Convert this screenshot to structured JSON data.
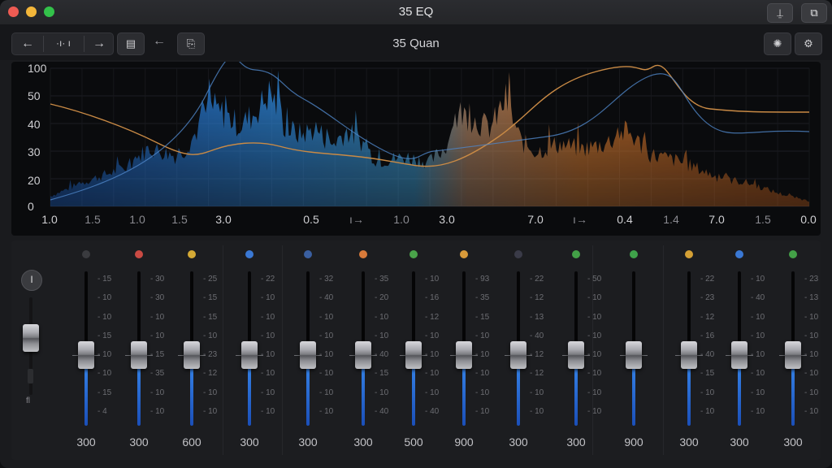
{
  "window": {
    "title": "35 EQ"
  },
  "titlebar_buttons": [
    {
      "icon": "share-icon",
      "glyph": "⍊"
    },
    {
      "icon": "window-icon",
      "glyph": "⧉"
    }
  ],
  "toolbar": {
    "back_glyph": "←",
    "mid_glyph": "·ı·  ı",
    "forward_glyph": "→",
    "doc_glyph": "▤",
    "undo_glyph": "←",
    "page_glyph": "⎘",
    "document_title": "35 Quan",
    "right_icons": [
      {
        "icon": "analyzer-icon",
        "glyph": "✺"
      },
      {
        "icon": "gear-icon",
        "glyph": "⚙"
      }
    ]
  },
  "graph": {
    "y_labels": [
      "100",
      "50",
      "40",
      "30",
      "20",
      "0"
    ],
    "x_labels": [
      {
        "text": "1.0",
        "dim": false
      },
      {
        "text": "1.5",
        "dim": true
      },
      {
        "text": "1.0",
        "dim": true
      },
      {
        "text": "1.5",
        "dim": true
      },
      {
        "text": "3.0",
        "dim": false
      },
      {
        "text": "0.5",
        "dim": false
      },
      {
        "text": "ı→",
        "dim": true
      },
      {
        "text": "1.0",
        "dim": true
      },
      {
        "text": "3.0",
        "dim": false
      },
      {
        "text": "7.0",
        "dim": false
      },
      {
        "text": "ı→",
        "dim": true
      },
      {
        "text": "0.4",
        "dim": false
      },
      {
        "text": "1.4",
        "dim": true
      },
      {
        "text": "7.0",
        "dim": false
      },
      {
        "text": "1.5",
        "dim": true
      },
      {
        "text": "0.0",
        "dim": false
      }
    ],
    "colors": {
      "blue": "#2f7fd8",
      "orange": "#d2782e",
      "curve_orange": "#c98a45",
      "curve_blue": "#4f86c8"
    }
  },
  "mixer": {
    "first_strip": {
      "solo_label": "I",
      "bottom_label": "fl"
    },
    "channels": [
      {
        "color": "#3a3b3f",
        "value": "300",
        "level": 0.52,
        "scale": [
          "15",
          "10",
          "10",
          "15",
          "10",
          "10",
          "15",
          "4"
        ],
        "scale_right": []
      },
      {
        "color": "#c94a43",
        "value": "300",
        "level": 0.52,
        "scale": [
          "30",
          "30",
          "10",
          "10",
          "15",
          "35",
          "10",
          "10"
        ],
        "scale_right": []
      },
      {
        "color": "#d4a935",
        "value": "600",
        "level": 0.52,
        "scale": [
          "25",
          "15",
          "15",
          "10",
          "23",
          "12",
          "10",
          "10"
        ],
        "scale_right": []
      },
      {
        "color": "#3a78d4",
        "value": "300",
        "level": 0.52,
        "scale": [
          "22",
          "10",
          "10",
          "10",
          "10",
          "10",
          "10",
          "10"
        ],
        "scale_right": []
      },
      {
        "color": "#3a5fa0",
        "value": "300",
        "level": 0.52,
        "scale": [
          "32",
          "40",
          "10",
          "10",
          "10",
          "10",
          "10",
          "10"
        ],
        "scale_right": []
      },
      {
        "color": "#d87a3a",
        "value": "300",
        "level": 0.52,
        "scale": [
          "35",
          "20",
          "10",
          "10",
          "40",
          "15",
          "10",
          "40"
        ],
        "scale_right": []
      },
      {
        "color": "#4aa34a",
        "value": "500",
        "level": 0.52,
        "scale": [
          "10",
          "16",
          "12",
          "10",
          "10",
          "10",
          "10",
          "40"
        ],
        "scale_right": []
      },
      {
        "color": "#d89a3a",
        "value": "900",
        "level": 0.52,
        "scale": [
          "93",
          "35",
          "15",
          "10",
          "10",
          "10",
          "10",
          "10"
        ],
        "scale_right": []
      },
      {
        "color": "#3a3b48",
        "value": "300",
        "level": 0.52,
        "scale": [
          "22",
          "12",
          "13",
          "40",
          "12",
          "12",
          "10",
          "10"
        ],
        "scale_right": []
      },
      {
        "color": "#43a047",
        "value": "300",
        "level": 0.52,
        "scale": [
          "50",
          "10",
          "10",
          "10",
          "10",
          "10",
          "10",
          "10"
        ],
        "scale_right": []
      },
      {
        "color": "#3fa34a",
        "value": "900",
        "level": 0.52,
        "scale": [],
        "scale_right": []
      },
      {
        "color": "#d4a035",
        "value": "300",
        "level": 0.52,
        "scale": [
          "22",
          "23",
          "12",
          "16",
          "40",
          "15",
          "10",
          "10"
        ],
        "scale_right": []
      },
      {
        "color": "#3a78d4",
        "value": "300",
        "level": 0.52,
        "scale": [
          "10",
          "40",
          "10",
          "10",
          "10",
          "10",
          "10",
          "10"
        ],
        "scale_right": []
      },
      {
        "color": "#43a047",
        "value": "300",
        "level": 0.52,
        "scale": [
          "23",
          "13",
          "10",
          "10",
          "10",
          "10",
          "10",
          "10"
        ],
        "scale_right": []
      }
    ]
  }
}
